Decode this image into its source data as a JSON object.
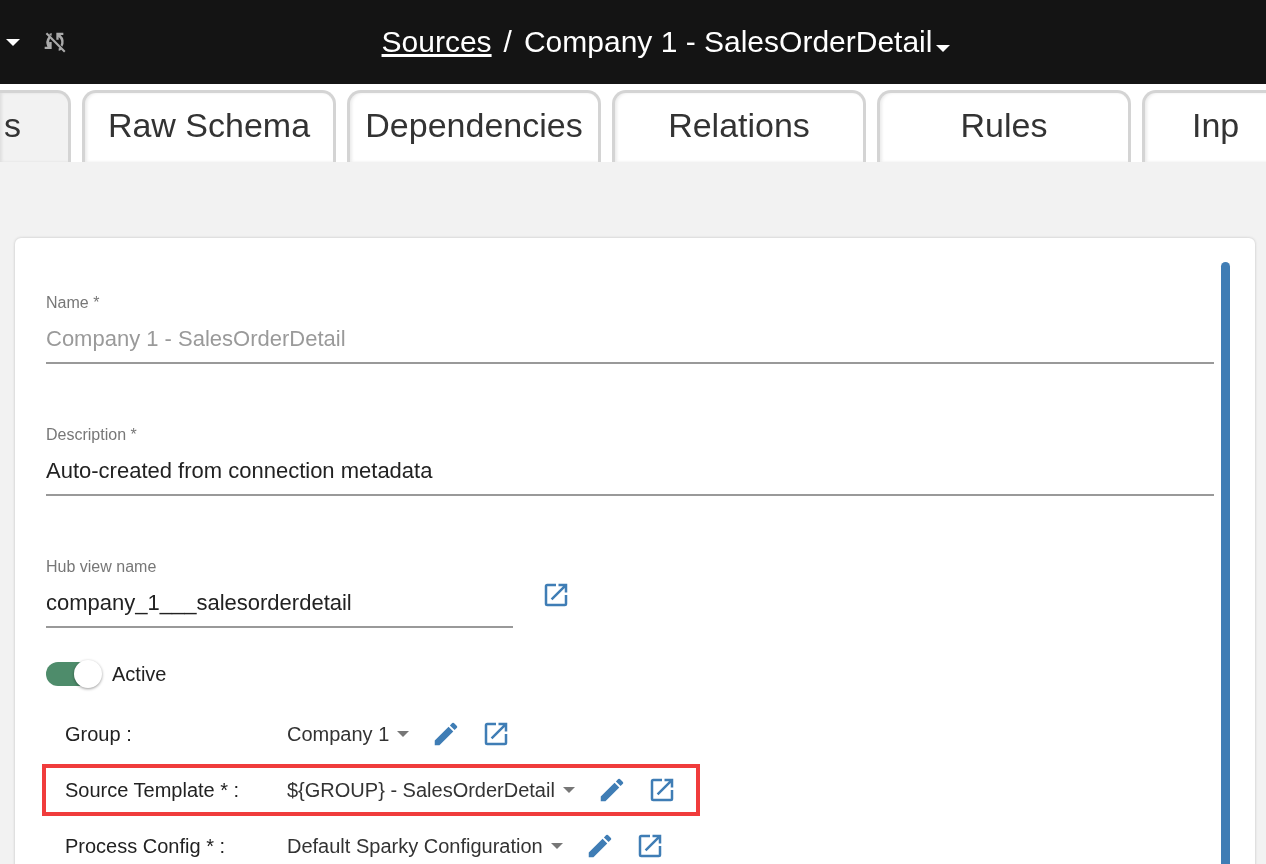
{
  "header": {
    "breadcrumb_link": "Sources",
    "separator": "/",
    "title": "Company 1 - SalesOrderDetail"
  },
  "tabs": [
    {
      "label": "s",
      "selected": true
    },
    {
      "label": "Raw Schema",
      "selected": false
    },
    {
      "label": "Dependencies",
      "selected": false
    },
    {
      "label": "Relations",
      "selected": false
    },
    {
      "label": "Rules",
      "selected": false
    },
    {
      "label": "Inp",
      "selected": false
    }
  ],
  "fields": [
    {
      "label": "Name *",
      "value": "Company 1 - SalesOrderDetail",
      "disabled": true,
      "link": false
    },
    {
      "label": "Description *",
      "value": "Auto-created from connection metadata",
      "disabled": false,
      "link": false
    },
    {
      "label": "Hub view name",
      "value": "company_1___salesorderdetail",
      "disabled": false,
      "link": true
    }
  ],
  "active": {
    "label": "Active",
    "on": true
  },
  "settings": [
    {
      "label": "Group :",
      "value": "Company 1",
      "highlighted": false
    },
    {
      "label": "Source Template * :",
      "value": "${GROUP} - SalesOrderDetail",
      "highlighted": true
    },
    {
      "label": "Process Config * :",
      "value": "Default Sparky Configuration",
      "highlighted": false
    }
  ]
}
